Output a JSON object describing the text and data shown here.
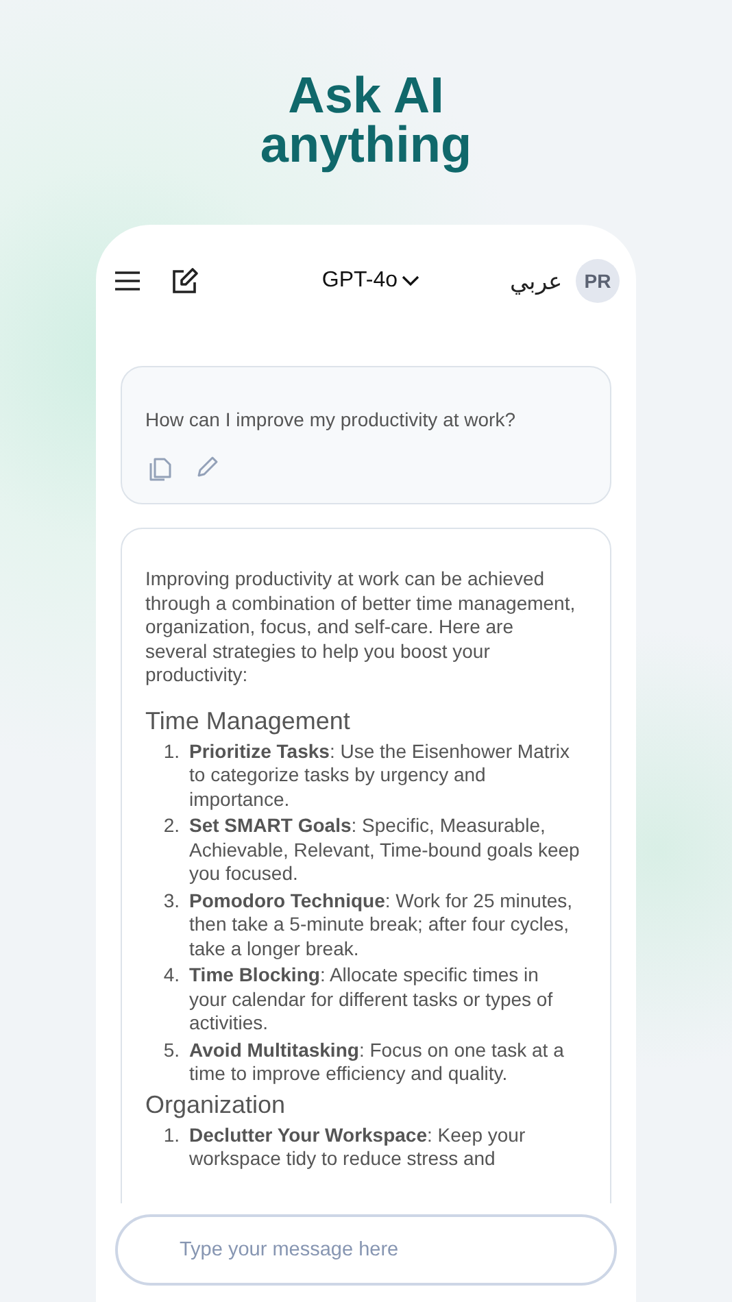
{
  "headline": "Ask AI anything",
  "header": {
    "model": "GPT-4o",
    "language": "عربي",
    "avatar_initials": "PR"
  },
  "user_message": {
    "text": "How can I improve my productivity at work?"
  },
  "response": {
    "intro": "Improving productivity at work can be achieved through a combination of better time management, organization, focus, and self-care. Here are several strategies to help you boost your productivity:",
    "sections": [
      {
        "heading": "Time Management",
        "items": [
          {
            "number": "1.",
            "text": "**Prioritize Tasks**: Use the Eisenhower Matrix to categorize tasks by urgency and importance."
          },
          {
            "number": "2.",
            "text": "**Set SMART Goals**: Specific, Measurable, Achievable, Relevant, Time-bound goals keep you focused."
          },
          {
            "number": "3.",
            "text": "**Pomodoro Technique**: Work for 25 minutes, then take a 5-minute break; after four cycles, take a longer break."
          },
          {
            "number": "4.",
            "text": "**Time Blocking**: Allocate specific times in your calendar for different tasks or types of activities."
          },
          {
            "number": "5.",
            "text": "**Avoid Multitasking**: Focus on one task at a time to improve efficiency and quality."
          }
        ]
      },
      {
        "heading": "Organization",
        "items": [
          {
            "number": "1.",
            "text": "**Declutter Your Workspace**: Keep your workspace tidy to reduce stress and"
          }
        ]
      }
    ]
  },
  "composer": {
    "placeholder": "Type your message here"
  }
}
